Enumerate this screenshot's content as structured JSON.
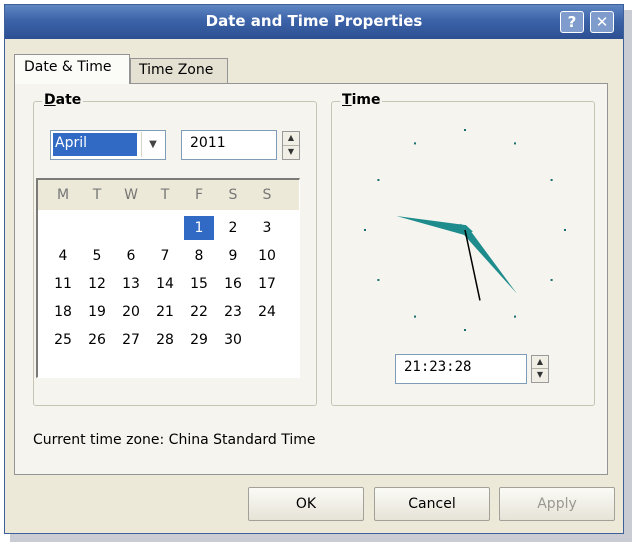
{
  "window": {
    "title": "Date and Time Properties",
    "help_label": "?",
    "close_label": "✕"
  },
  "tabs": [
    {
      "label": "Date & Time",
      "active": true
    },
    {
      "label": "Time Zone",
      "active": false
    }
  ],
  "date_group": {
    "label_first": "D",
    "label_rest": "ate",
    "month": "April",
    "year": "2011"
  },
  "calendar": {
    "days_of_week": [
      "M",
      "T",
      "W",
      "T",
      "F",
      "S",
      "S"
    ],
    "selected_day": "1",
    "weeks": [
      [
        "",
        "",
        "",
        "",
        "1",
        "2",
        "3"
      ],
      [
        "4",
        "5",
        "6",
        "7",
        "8",
        "9",
        "10"
      ],
      [
        "11",
        "12",
        "13",
        "14",
        "15",
        "16",
        "17"
      ],
      [
        "18",
        "19",
        "20",
        "21",
        "22",
        "23",
        "24"
      ],
      [
        "25",
        "26",
        "27",
        "28",
        "29",
        "30",
        ""
      ]
    ]
  },
  "time_group": {
    "label_first": "T",
    "label_rest": "ime",
    "time_value": "21:23:28",
    "clock": {
      "hour": 21,
      "minute": 23,
      "second": 28
    },
    "hand_color": "#1e8c8c"
  },
  "timezone_text": "Current time zone:  China Standard Time",
  "buttons": {
    "ok": "OK",
    "cancel": "Cancel",
    "apply": "Apply"
  },
  "colors": {
    "titlebar": "#3c63a8",
    "selection": "#316ac5",
    "dialog_bg": "#ece9d8"
  }
}
